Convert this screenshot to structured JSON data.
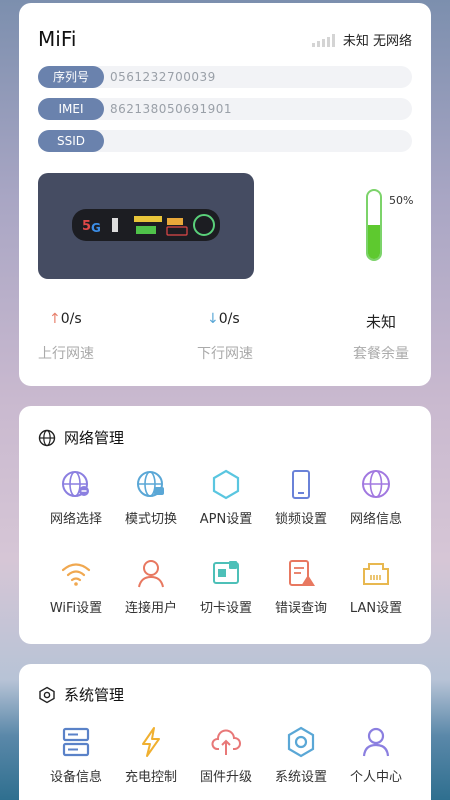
{
  "device": {
    "title": "MiFi",
    "status": "未知 无网络",
    "info": [
      {
        "label": "序列号",
        "value": "0561232700039"
      },
      {
        "label": "IMEI",
        "value": "862138050691901"
      },
      {
        "label": "SSID",
        "value": ""
      }
    ],
    "battery_percent": 50,
    "battery_label": "50%",
    "upload_value": "0/s",
    "upload_label": "上行网速",
    "download_value": "0/s",
    "download_label": "下行网速",
    "data_remaining_value": "未知",
    "data_remaining_label": "套餐余量"
  },
  "network": {
    "title": "网络管理",
    "items": [
      {
        "label": "网络选择",
        "icon": "globe-select-icon"
      },
      {
        "label": "模式切换",
        "icon": "globe-switch-icon"
      },
      {
        "label": "APN设置",
        "icon": "hexagon-icon"
      },
      {
        "label": "锁频设置",
        "icon": "phone-icon"
      },
      {
        "label": "网络信息",
        "icon": "globe-icon"
      },
      {
        "label": "WiFi设置",
        "icon": "wifi-icon"
      },
      {
        "label": "连接用户",
        "icon": "user-icon"
      },
      {
        "label": "切卡设置",
        "icon": "sim-card-icon"
      },
      {
        "label": "错误查询",
        "icon": "error-report-icon"
      },
      {
        "label": "LAN设置",
        "icon": "lan-port-icon"
      }
    ]
  },
  "system": {
    "title": "系统管理",
    "items": [
      {
        "label": "设备信息",
        "icon": "server-icon"
      },
      {
        "label": "充电控制",
        "icon": "lightning-icon"
      },
      {
        "label": "固件升级",
        "icon": "cloud-upload-icon"
      },
      {
        "label": "系统设置",
        "icon": "settings-icon"
      },
      {
        "label": "个人中心",
        "icon": "person-icon"
      }
    ]
  },
  "colors": {
    "label_bg": "#6a82ad",
    "battery_green": "#5ec92f",
    "upload_arrow": "#e77f6b",
    "download_arrow": "#5aa7d6"
  }
}
